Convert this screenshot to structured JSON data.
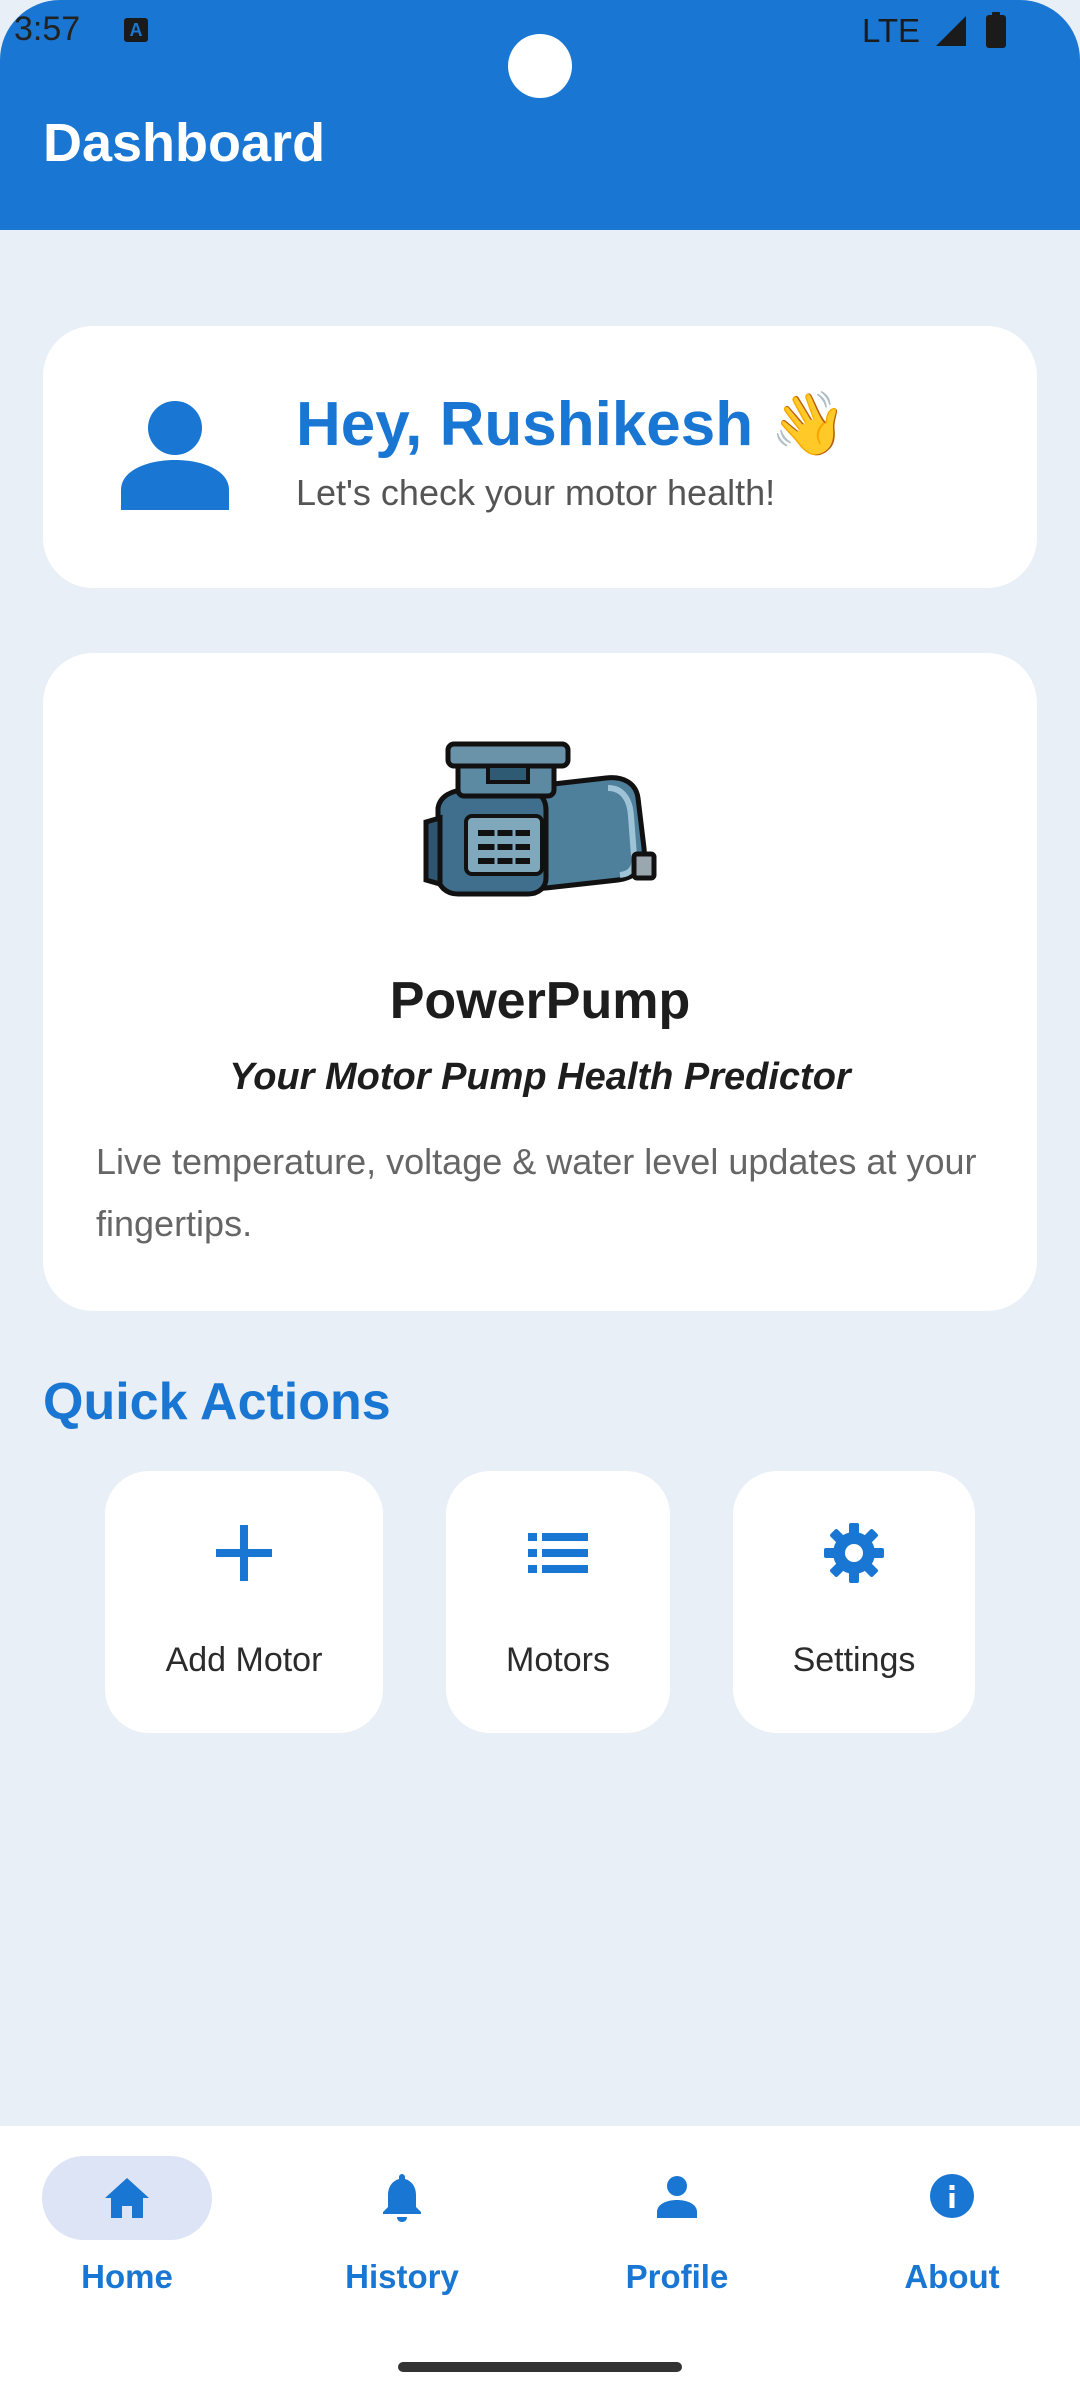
{
  "status_bar": {
    "time": "3:57",
    "network": "LTE",
    "icons": [
      "accessibility-icon",
      "signal-icon",
      "battery-icon"
    ]
  },
  "app_bar": {
    "title": "Dashboard",
    "color": "#1976d2"
  },
  "greeting": {
    "title": "Hey, Rushikesh 👋",
    "subtitle": "Let's check your motor health!",
    "icon": "person-icon"
  },
  "brand": {
    "name": "PowerPump",
    "tagline": "Your Motor Pump Health Predictor",
    "description": "Live temperature, voltage & water level updates at your fingertips.",
    "image": "motor-pump-illustration"
  },
  "quick_actions": {
    "title": "Quick Actions",
    "items": [
      {
        "label": "Add Motor",
        "icon": "plus-icon"
      },
      {
        "label": "Motors",
        "icon": "list-icon"
      },
      {
        "label": "Settings",
        "icon": "gear-icon"
      }
    ]
  },
  "bottom_nav": {
    "active": "Home",
    "items": [
      {
        "label": "Home",
        "icon": "home-icon"
      },
      {
        "label": "History",
        "icon": "bell-icon"
      },
      {
        "label": "Profile",
        "icon": "person-icon"
      },
      {
        "label": "About",
        "icon": "info-icon"
      }
    ]
  },
  "colors": {
    "primary": "#1976d2",
    "background": "#e8eff7",
    "card": "#ffffff",
    "nav_active_pill": "#dde4f6"
  }
}
